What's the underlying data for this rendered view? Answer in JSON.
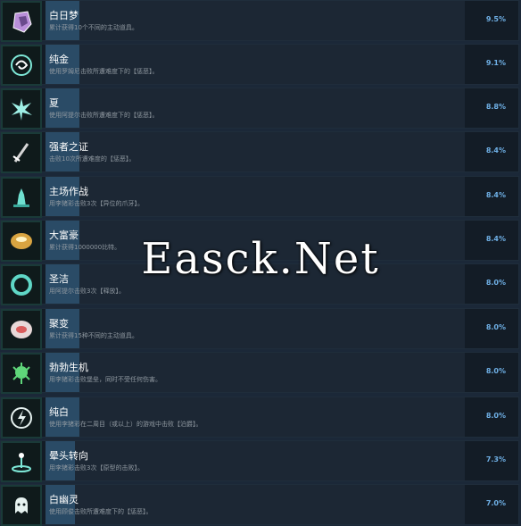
{
  "achievements": [
    {
      "title": "白日梦",
      "desc": "累计获得10个不同的主动道具。",
      "pct": "9.5%",
      "progress": 0.08,
      "icon": "purple-crystal-icon",
      "color": "#b98fd9"
    },
    {
      "title": "纯金",
      "desc": "使用罗姆尼击败所遭难度下的【惩恶】。",
      "pct": "9.1%",
      "progress": 0.08,
      "icon": "swirl-orb-icon",
      "color": "#7ee8d8"
    },
    {
      "title": "夏",
      "desc": "使用阿提尔击败所遭难度下的【惩恶】。",
      "pct": "8.8%",
      "progress": 0.08,
      "icon": "ice-burst-icon",
      "color": "#9ff0e6"
    },
    {
      "title": "强者之证",
      "desc": "击败10次所遭难度的【惩恶】。",
      "pct": "8.4%",
      "progress": 0.08,
      "icon": "sword-icon",
      "color": "#d6d6d6"
    },
    {
      "title": "主场作战",
      "desc": "用李猪彩击败3次【异位的爪牙】。",
      "pct": "8.4%",
      "progress": 0.08,
      "icon": "fortress-icon",
      "color": "#6fe0d0"
    },
    {
      "title": "大富豪",
      "desc": "累计获得1000000比特。",
      "pct": "8.4%",
      "progress": 0.08,
      "icon": "gold-orb-icon",
      "color": "#d9a441"
    },
    {
      "title": "圣洁",
      "desc": "用阿提尔击败3次【释放】。",
      "pct": "8.0%",
      "progress": 0.08,
      "icon": "ring-icon",
      "color": "#5fd6c6"
    },
    {
      "title": "聚变",
      "desc": "累计获得15种不同的主动道具。",
      "pct": "8.0%",
      "progress": 0.08,
      "icon": "red-seed-icon",
      "color": "#d95c5c"
    },
    {
      "title": "勃勃生机",
      "desc": "用李猪彩击败堡垒，同时不受任何伤害。",
      "pct": "8.0%",
      "progress": 0.08,
      "icon": "spore-icon",
      "color": "#5fd67a"
    },
    {
      "title": "纯白",
      "desc": "使用李猪彩在二周目（或以上）的游戏中击败【泊爵】。",
      "pct": "8.0%",
      "progress": 0.08,
      "icon": "lightning-circle-icon",
      "color": "#e6f2f0"
    },
    {
      "title": "晕头转向",
      "desc": "用李猪彩击败3次【原型的击败】。",
      "pct": "7.3%",
      "progress": 0.07,
      "icon": "beacon-icon",
      "color": "#7ee8d8"
    },
    {
      "title": "白幽灵",
      "desc": "使用顾俊击败所遭难度下的【惩恶】。",
      "pct": "7.0%",
      "progress": 0.07,
      "icon": "ghost-icon",
      "color": "#e6f2f0"
    }
  ],
  "watermark": "Easck.Net"
}
